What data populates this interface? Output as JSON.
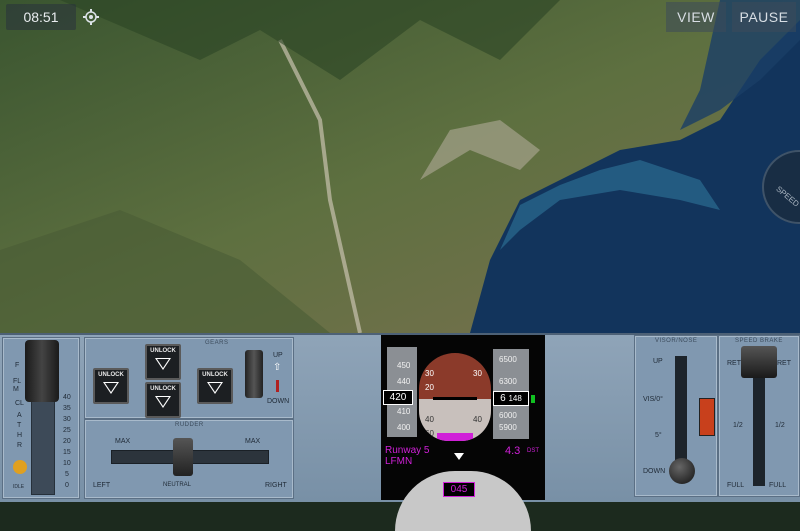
{
  "hud": {
    "time": "08:51",
    "view_label": "VIEW",
    "pause_label": "PAUSE",
    "compass_text": "SPEED"
  },
  "panel": {
    "throttle": {
      "labels_left": [
        "F",
        "FL",
        "M",
        "CL",
        "A",
        "T",
        "H",
        "R"
      ],
      "scale": [
        "40",
        "35",
        "30",
        "25",
        "20",
        "15",
        "10",
        "5",
        "0"
      ],
      "idle_label": "IDLE"
    },
    "gears": {
      "title": "GEARS",
      "unlock_label": "UNLOCK",
      "lever_up": "UP",
      "lever_down": "DOWN"
    },
    "rudder": {
      "title": "RUDDER",
      "max_left": "MAX",
      "max_right": "MAX",
      "left": "LEFT",
      "neutral": "NEUTRAL",
      "right": "RIGHT"
    },
    "visor": {
      "title": "VISOR/NOSE",
      "up": "UP",
      "vis": "VIS/0°",
      "five": "5°",
      "down": "DOWN"
    },
    "speedbrake": {
      "title": "SPEED BRAKE",
      "ret_left": "RET",
      "ret_right": "RET",
      "half_left": "1/2",
      "half_right": "1/2",
      "full_left": "FULL",
      "full_right": "FULL"
    }
  },
  "pfd": {
    "speed_ticks": [
      "450",
      "440",
      "430",
      "420",
      "410",
      "400"
    ],
    "speed_value": "420",
    "alt_ticks": [
      "6500",
      "6400",
      "6300",
      "6200",
      "6100",
      "6000",
      "5900",
      "5800"
    ],
    "alt_value_big": "6",
    "alt_value_small": "148",
    "pitch_left": [
      "40",
      "30",
      "20",
      "10",
      "10",
      "20",
      "30",
      "40",
      "60"
    ],
    "pitch_right": [
      "40",
      "30",
      "20",
      "10",
      "10",
      "20",
      "30",
      "40",
      "60"
    ],
    "runway": "Runway 5",
    "airport": "LFMN",
    "dist_value": "4.3",
    "dist_unit": "DST",
    "heading": "045"
  },
  "colors": {
    "panel": "#8fa4b8",
    "magenta": "#d020d8",
    "pfd_bg": "#050505",
    "sky_pfd": "#8b3a2a",
    "ground_pfd": "#c8c0bc"
  }
}
